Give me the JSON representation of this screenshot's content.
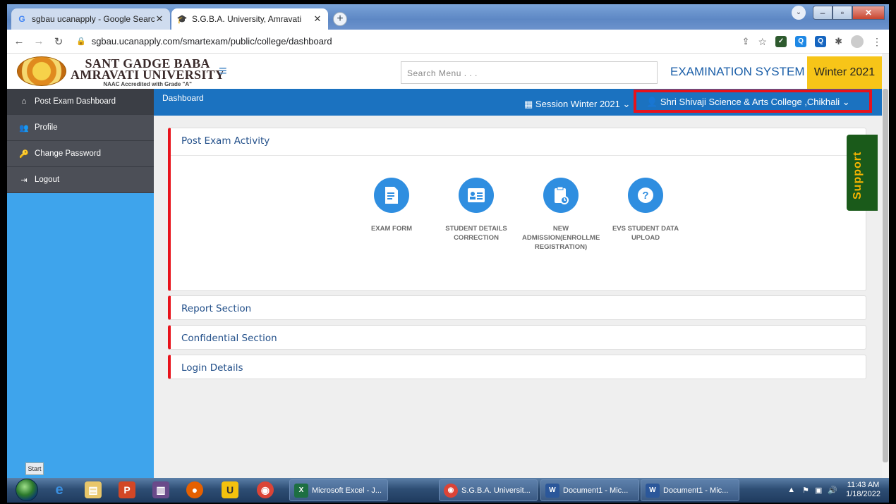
{
  "browser": {
    "tabs": [
      {
        "icon": "google-icon",
        "title": "sgbau ucanapply - Google Searcl",
        "active": false
      },
      {
        "icon": "graduation-cap-icon",
        "title": "S.G.B.A. University, Amravati",
        "active": true
      }
    ],
    "url": "sgbau.ucanapply.com/smartexam/public/college/dashboard"
  },
  "header": {
    "logo_line1": "SANT GADGE BABA",
    "logo_line2": "AMRAVATI UNIVERSITY",
    "logo_line3": "NAAC Accredited with Grade \"A\"",
    "search_placeholder": "Search Menu . . .",
    "exam_system": "EXAMINATION SYSTEM",
    "session_badge": "Winter 2021"
  },
  "sidebar": {
    "items": [
      {
        "icon": "home-icon",
        "label": "Post Exam Dashboard"
      },
      {
        "icon": "users-icon",
        "label": "Profile"
      },
      {
        "icon": "key-icon",
        "label": "Change Password"
      },
      {
        "icon": "logout-icon",
        "label": "Logout"
      }
    ],
    "start_label": "Start"
  },
  "topbar": {
    "breadcrumb": "Dashboard",
    "session_label": "Session  Winter 2021",
    "college_label": "Shri Shivaji Science & Arts College ,Chikhali"
  },
  "sections": {
    "post_exam": {
      "title": "Post Exam Activity",
      "activities": [
        {
          "icon": "exam-form-icon",
          "label": "EXAM FORM"
        },
        {
          "icon": "student-details-icon",
          "label": "STUDENT DETAILS\nCORRECTION"
        },
        {
          "icon": "new-admission-icon",
          "label": "NEW\nADMISSION(ENROLLME\nREGISTRATION)"
        },
        {
          "icon": "question-icon",
          "label": "EVS STUDENT DATA\nUPLOAD"
        }
      ]
    },
    "report": {
      "title": "Report Section"
    },
    "confidential": {
      "title": "Confidential Section"
    },
    "login": {
      "title": "Login Details"
    }
  },
  "support_label": "Support",
  "taskbar": {
    "tasks": [
      {
        "icon": "excel-icon",
        "label": "Microsoft Excel - J..."
      },
      {
        "icon": "chrome-icon",
        "label": "S.G.B.A. Universit..."
      },
      {
        "icon": "word-icon",
        "label": "Document1 - Mic..."
      },
      {
        "icon": "word-icon",
        "label": "Document1 - Mic..."
      }
    ],
    "time": "11:43 AM",
    "date": "1/18/2022"
  },
  "colors": {
    "topbar": "#1b72c0",
    "sidebar": "#3ea4ec",
    "highlight": "#e8121b",
    "badge": "#f7c518"
  }
}
